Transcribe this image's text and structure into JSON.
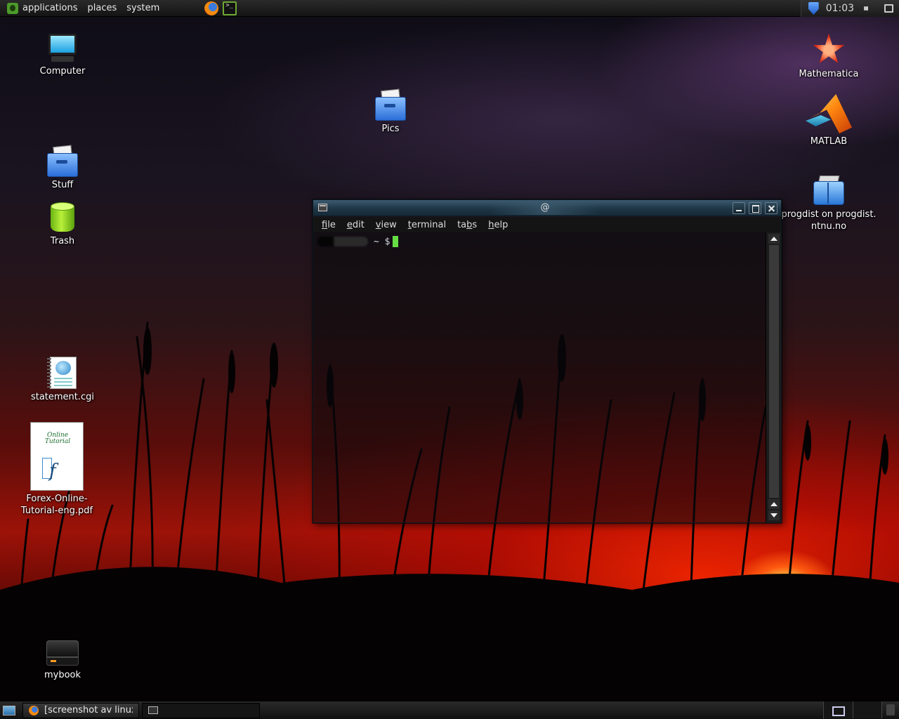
{
  "top_panel": {
    "menus": [
      "applications",
      "places",
      "system"
    ],
    "clock": "01:03"
  },
  "desktop": {
    "icons": {
      "computer": "Computer",
      "pics": "Pics",
      "stuff": "Stuff",
      "trash": "Trash",
      "statement": "statement.cgi",
      "forex_line1": "Forex-Online-",
      "forex_line2": "Tutorial-eng.pdf",
      "mybook": "mybook",
      "mathematica": "Mathematica",
      "matlab": "MATLAB",
      "progdist_line1": "progdist on progdist.",
      "progdist_line2": "ntnu.no"
    },
    "pdf_thumb_title": "Online Tutorial",
    "pdf_thumb_sub": "f"
  },
  "terminal": {
    "title": "@",
    "menu": [
      {
        "pre": "",
        "u": "f",
        "post": "ile"
      },
      {
        "pre": "",
        "u": "e",
        "post": "dit"
      },
      {
        "pre": "",
        "u": "v",
        "post": "iew"
      },
      {
        "pre": "",
        "u": "t",
        "post": "erminal"
      },
      {
        "pre": "ta",
        "u": "b",
        "post": "s"
      },
      {
        "pre": "",
        "u": "h",
        "post": "elp"
      }
    ],
    "prompt": "~ $"
  },
  "taskbar": {
    "task1": "[screenshot av linux..",
    "task2": ""
  },
  "colors": {
    "cursor": "#66dd44",
    "titlebar": "#1e3646"
  }
}
